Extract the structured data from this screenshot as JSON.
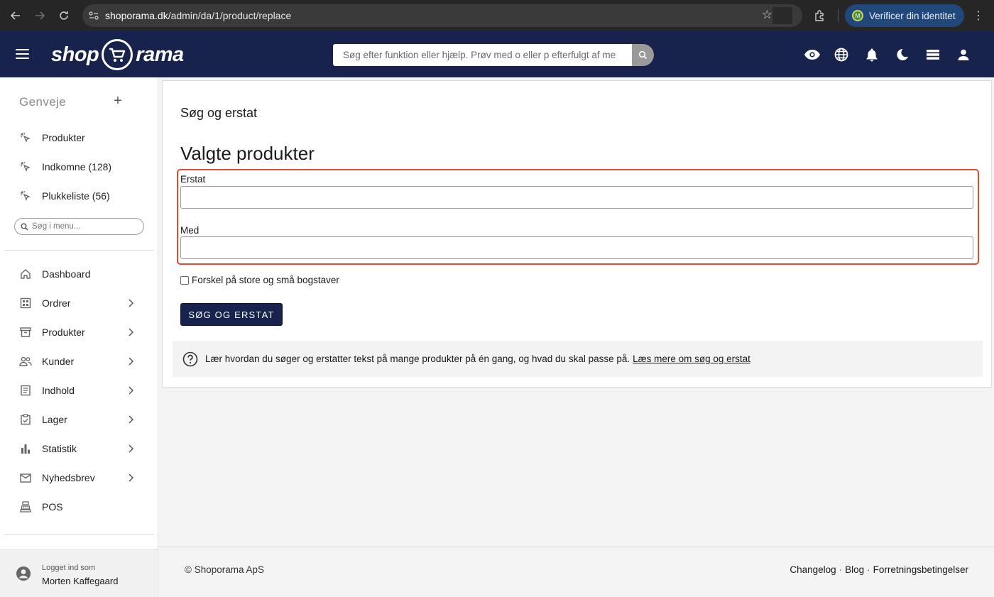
{
  "browser": {
    "url_host": "shoporama.dk",
    "url_path": "/admin/da/1/product/replace",
    "profile_initial": "M",
    "verify_label": "Verificer din identitet"
  },
  "header": {
    "logo_left": "shop",
    "logo_right": "rama",
    "search_placeholder": "Søg efter funktion eller hjælp. Prøv med o eller p efterfulgt af me",
    "icons": [
      "eye-icon",
      "globe-icon",
      "bell-icon",
      "moon-icon",
      "stack-icon",
      "user-icon"
    ],
    "brand_color": "#17224d"
  },
  "sidebar": {
    "shortcuts_title": "Genveje",
    "shortcuts": [
      {
        "label": "Produkter",
        "icon": "sparkle-cursor-icon"
      },
      {
        "label": "Indkomne (128)",
        "icon": "sparkle-cursor-icon"
      },
      {
        "label": "Plukkeliste (56)",
        "icon": "sparkle-cursor-icon"
      }
    ],
    "menu_search_placeholder": "Søg i menu...",
    "nav": [
      {
        "label": "Dashboard",
        "icon": "home-icon",
        "has_children": false
      },
      {
        "label": "Ordrer",
        "icon": "grid-icon",
        "has_children": true
      },
      {
        "label": "Produkter",
        "icon": "archive-icon",
        "has_children": true
      },
      {
        "label": "Kunder",
        "icon": "people-icon",
        "has_children": true
      },
      {
        "label": "Indhold",
        "icon": "document-icon",
        "has_children": true
      },
      {
        "label": "Lager",
        "icon": "clipboard-check-icon",
        "has_children": true
      },
      {
        "label": "Statistik",
        "icon": "bar-chart-icon",
        "has_children": true
      },
      {
        "label": "Nyhedsbrev",
        "icon": "mail-icon",
        "has_children": true
      },
      {
        "label": "POS",
        "icon": "register-icon",
        "has_children": false
      }
    ],
    "login_caption": "Logget ind som",
    "login_name": "Morten Kaffegaard"
  },
  "main": {
    "card_title": "Søg og erstat",
    "section_title": "Valgte produkter",
    "replace_label": "Erstat",
    "replace_value": "",
    "with_label": "Med",
    "with_value": "",
    "case_checkbox_label": "Forskel på store og små bogstaver",
    "case_checked": false,
    "submit_label": "SØG OG ERSTAT",
    "info_text": "Lær hvordan du søger og erstatter tekst på mange produkter på én gang, og hvad du skal passe på.",
    "info_link": "Læs mere om søg og erstat",
    "highlight_color": "#e34a2e"
  },
  "footer": {
    "copyright": "© Shoporama ApS",
    "links": [
      "Changelog",
      "Blog",
      "Forretningsbetingelser"
    ],
    "separator": "·"
  }
}
